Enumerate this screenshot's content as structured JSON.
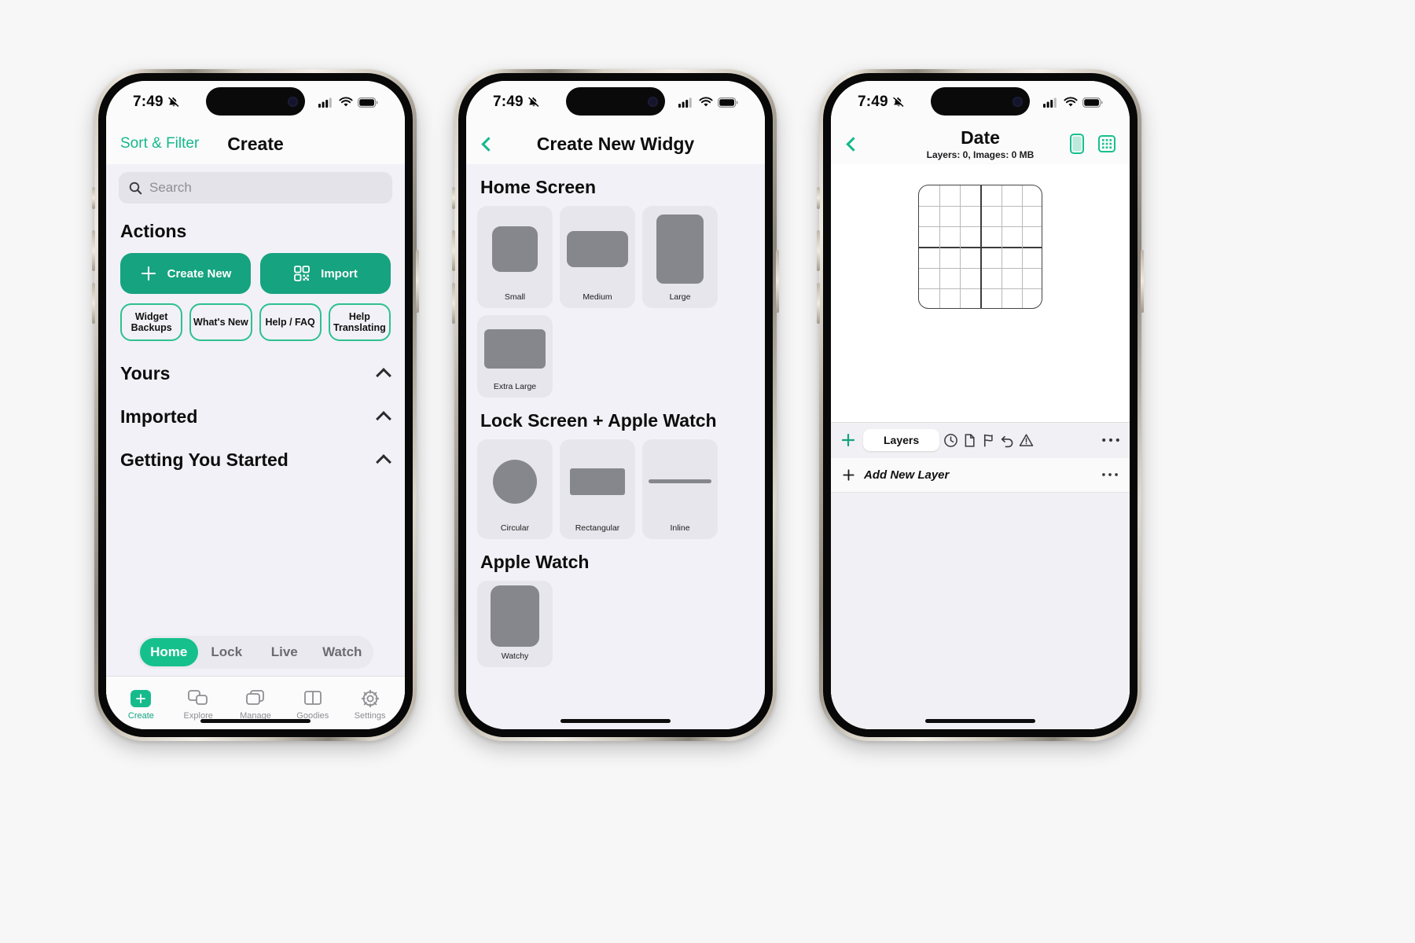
{
  "theme": {
    "accent": "#16a37f",
    "accent_bright": "#16c08c",
    "accent_outline": "#2fc08f",
    "page_bg": "#f7f7f7",
    "screen_bg": "#f1f1f7",
    "card_bg": "#e6e6ec",
    "shape_gray": "#86868d"
  },
  "status_bar": {
    "time": "7:49",
    "silent_icon": "bell-slash-icon",
    "cellular_icon": "cellular-bars-icon",
    "wifi_icon": "wifi-icon",
    "battery_icon": "battery-icon"
  },
  "phone1": {
    "nav": {
      "left_action": "Sort & Filter",
      "title": "Create"
    },
    "search": {
      "placeholder": "Search",
      "value": "",
      "icon": "search-icon"
    },
    "actions": {
      "heading": "Actions",
      "primary": [
        {
          "label": "Create New",
          "icon": "plus-icon"
        },
        {
          "label": "Import",
          "icon": "qr-code-icon"
        }
      ],
      "secondary": [
        {
          "label": "Widget Backups"
        },
        {
          "label": "What's New"
        },
        {
          "label": "Help / FAQ"
        },
        {
          "label": "Help Translating"
        }
      ]
    },
    "sections": [
      {
        "title": "Yours",
        "chevron": "chevron-up-icon"
      },
      {
        "title": "Imported",
        "chevron": "chevron-up-icon"
      },
      {
        "title": "Getting You Started",
        "chevron": "chevron-up-icon"
      }
    ],
    "segmented": {
      "selected": "Home",
      "options": [
        "Home",
        "Lock",
        "Live",
        "Watch"
      ]
    },
    "tabbar": [
      {
        "label": "Create",
        "icon": "plus-square-icon",
        "active": true
      },
      {
        "label": "Explore",
        "icon": "two-squares-icon",
        "active": false
      },
      {
        "label": "Manage",
        "icon": "stacked-cards-icon",
        "active": false
      },
      {
        "label": "Goodies",
        "icon": "split-panel-icon",
        "active": false
      },
      {
        "label": "Settings",
        "icon": "gear-icon",
        "active": false
      }
    ]
  },
  "phone2": {
    "nav": {
      "back_icon": "chevron-left-icon",
      "title": "Create New Widgy"
    },
    "sections": [
      {
        "heading": "Home Screen",
        "items": [
          {
            "label": "Small",
            "shape": "square"
          },
          {
            "label": "Medium",
            "shape": "wide"
          },
          {
            "label": "Large",
            "shape": "tall"
          },
          {
            "label": "Extra Large",
            "shape": "xwide"
          }
        ]
      },
      {
        "heading": "Lock Screen + Apple Watch",
        "items": [
          {
            "label": "Circular",
            "shape": "circle"
          },
          {
            "label": "Rectangular",
            "shape": "rect"
          },
          {
            "label": "Inline",
            "shape": "line"
          }
        ]
      },
      {
        "heading": "Apple Watch",
        "items": [
          {
            "label": "Watchy",
            "shape": "watch"
          }
        ]
      }
    ]
  },
  "phone3": {
    "nav": {
      "back_icon": "chevron-left-icon",
      "title": "Date",
      "subtitle": "Layers: 0, Images: 0 MB",
      "right_icons": [
        "phone-preview-icon",
        "grid-toggle-icon"
      ]
    },
    "toolbar": {
      "add_icon": "plus-icon",
      "tab_label": "Layers",
      "icons": [
        "history-icon",
        "document-icon",
        "flag-icon",
        "undo-icon",
        "warning-icon",
        "more-icon"
      ]
    },
    "layer_row": {
      "add_icon": "plus-icon",
      "label": "Add New Layer",
      "more_icon": "more-icon"
    }
  }
}
